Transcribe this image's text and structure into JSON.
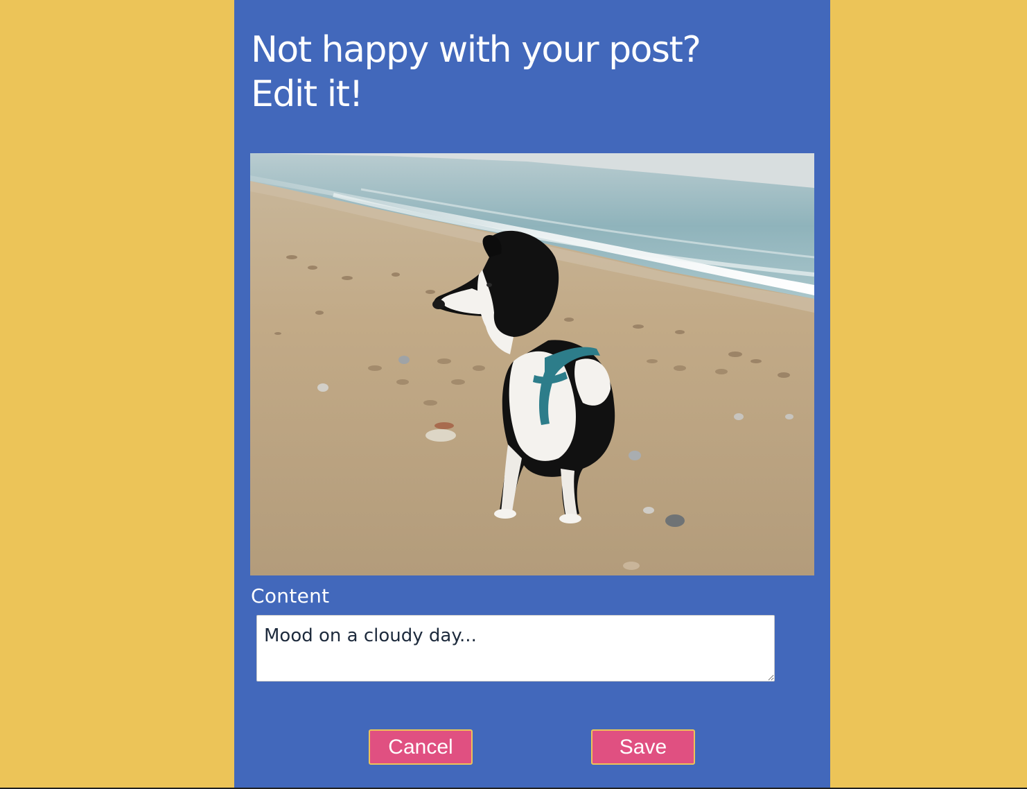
{
  "page": {
    "title_line1": "Not happy with your post?",
    "title_line2": "Edit it!"
  },
  "post": {
    "image_description": "black-and-white-dog-on-beach-photo",
    "content_label": "Content",
    "content_value": "Mood on a cloudy day..."
  },
  "actions": {
    "cancel_label": "Cancel",
    "save_label": "Save"
  },
  "colors": {
    "background": "#ECC458",
    "panel": "#4268BB",
    "button": "#E05081",
    "button_border": "#ECC458",
    "text_light": "#ffffff"
  }
}
